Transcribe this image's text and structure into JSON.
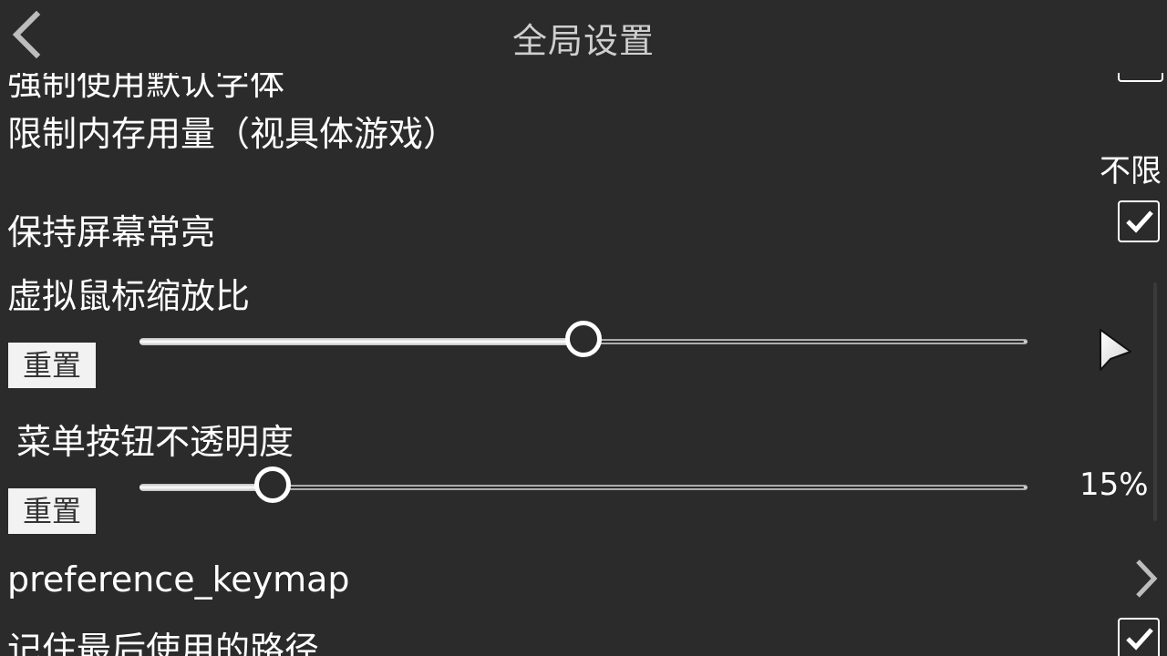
{
  "header": {
    "title": "全局设置"
  },
  "settings": {
    "partial_top_label": "强制使用默认字体",
    "memory_limit": {
      "label": "限制内存用量（视具体游戏）",
      "value": "不限"
    },
    "keep_screen_on": {
      "label": "保持屏幕常亮",
      "checked": true
    },
    "mouse_scale": {
      "label": "虚拟鼠标缩放比",
      "reset_label": "重置",
      "slider_fraction": 0.5
    },
    "menu_opacity": {
      "label": "菜单按钮不透明度",
      "reset_label": "重置",
      "value_text": "15%",
      "slider_fraction": 0.15
    },
    "keymap": {
      "label": "preference_keymap"
    },
    "remember_path": {
      "label": "记住最后使用的路径",
      "checked": true
    }
  },
  "icons": {
    "back": "chevron-left-icon",
    "cursor_preview": "mouse-cursor-icon",
    "keymap_arrow": "chevron-right-icon",
    "checkmark": "checkmark-icon"
  },
  "colors": {
    "background": "#2b2b2b",
    "text": "#ffffff",
    "title": "#cfcfcf",
    "reset_button_bg": "#f2f2f2"
  }
}
